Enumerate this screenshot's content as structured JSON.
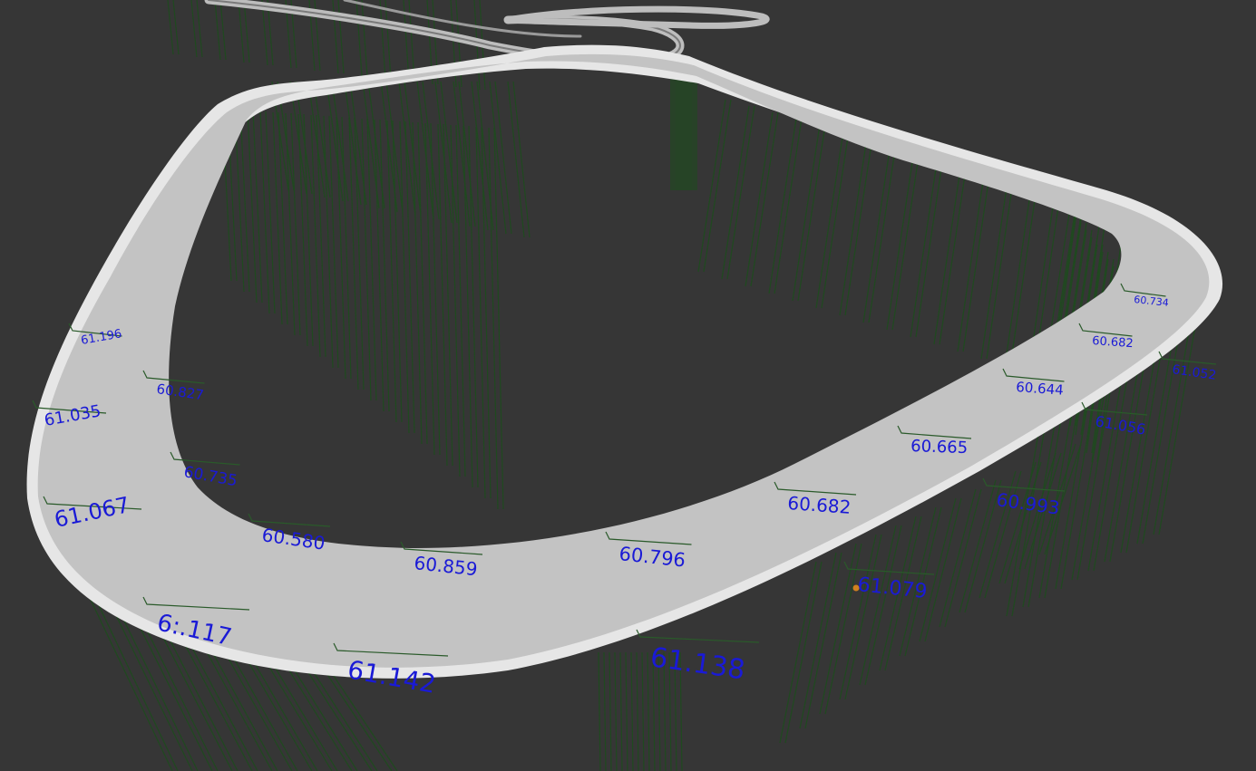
{
  "scene": {
    "background_color": "#363636",
    "road_color": "#c4c4c4",
    "road_edge_color": "#e8e8e8",
    "pile_color": "#1f4a1f",
    "label_color": "#1a1ad6"
  },
  "outer_labels": [
    {
      "id": "o1",
      "text": "61.067"
    },
    {
      "id": "o2",
      "text": "61.035"
    },
    {
      "id": "o3",
      "text": "61.196"
    },
    {
      "id": "o4",
      "text": "6:.117"
    },
    {
      "id": "o5",
      "text": "61.142"
    },
    {
      "id": "o6",
      "text": "61.138"
    },
    {
      "id": "o7",
      "text": "61.079"
    },
    {
      "id": "o8",
      "text": "60.993"
    },
    {
      "id": "o9",
      "text": "61.056"
    },
    {
      "id": "o10",
      "text": "61.052"
    }
  ],
  "inner_labels": [
    {
      "id": "i1",
      "text": "60.827"
    },
    {
      "id": "i2",
      "text": "60.735"
    },
    {
      "id": "i3",
      "text": "60.580"
    },
    {
      "id": "i4",
      "text": "60.859"
    },
    {
      "id": "i5",
      "text": "60.796"
    },
    {
      "id": "i6",
      "text": "60.682"
    },
    {
      "id": "i7",
      "text": "60.665"
    },
    {
      "id": "i8",
      "text": "60.644"
    },
    {
      "id": "i9",
      "text": "60.682"
    },
    {
      "id": "i10",
      "text": "60.734"
    }
  ]
}
